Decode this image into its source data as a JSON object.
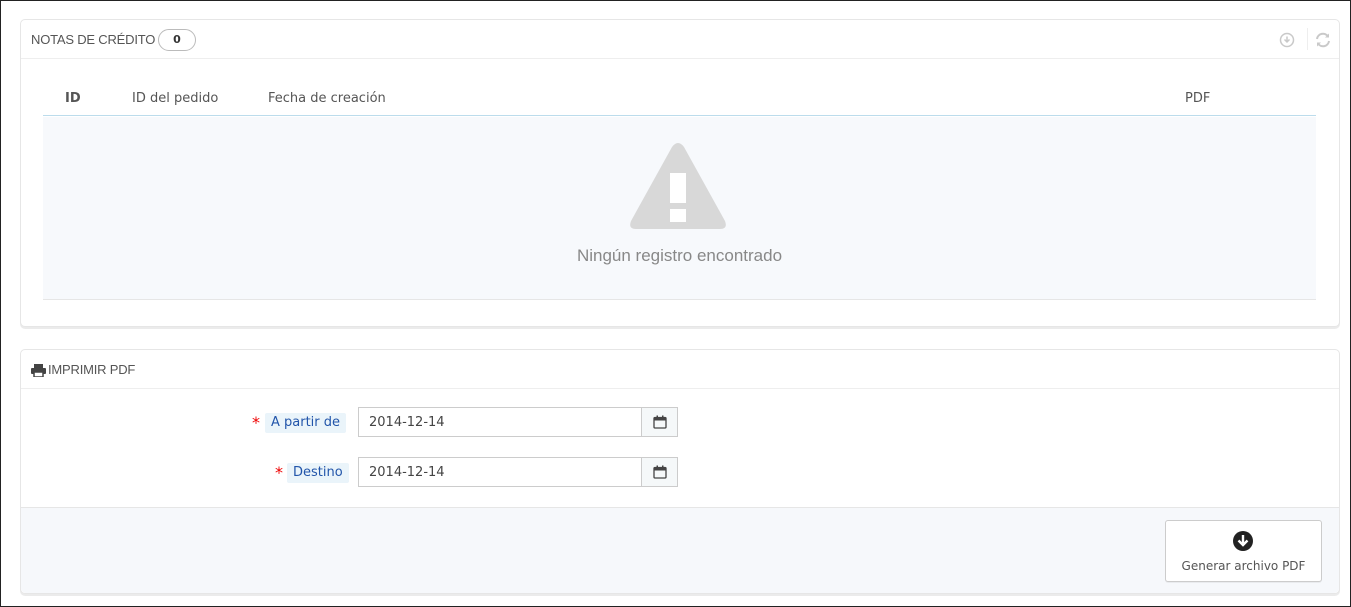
{
  "credit_notes": {
    "title": "NOTAS DE CRÉDITO",
    "count": "0",
    "icons": [
      "download-icon",
      "refresh-icon"
    ],
    "columns": [
      "ID",
      "ID del pedido",
      "Fecha de creación",
      "PDF"
    ],
    "empty_message": "Ningún registro encontrado"
  },
  "print_pdf": {
    "title": "IMPRIMIR PDF",
    "from": {
      "label": "A partir de",
      "value": "2014-12-14",
      "required_mark": "*"
    },
    "to": {
      "label": "Destino",
      "value": "2014-12-14",
      "required_mark": "*"
    },
    "generate_label": "Generar archivo PDF"
  },
  "colors": {
    "required": "#e00000",
    "label_bg": "#eaf4fa",
    "label_text": "#2255aa",
    "warning_icon": "#d8d8d8"
  }
}
